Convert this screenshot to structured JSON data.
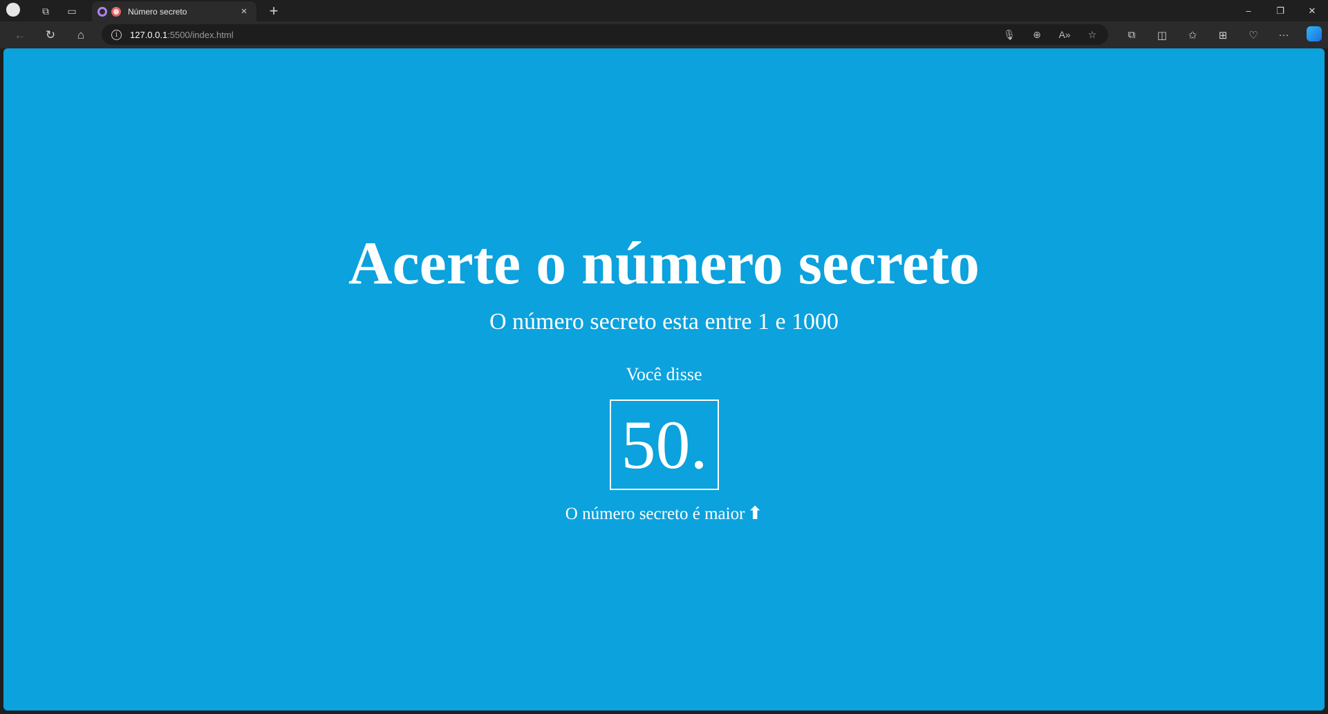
{
  "browser": {
    "tab": {
      "title": "Número secreto",
      "close": "×"
    },
    "new_tab": "+",
    "window_controls": {
      "minimize": "–",
      "restore": "❐",
      "close": "✕"
    },
    "nav": {
      "back": "←",
      "reload": "↻",
      "home": "⌂"
    },
    "address": {
      "host": "127.0.0.1",
      "path": ":5500/index.html",
      "info": "i"
    },
    "url_icons": {
      "mic": "🎙",
      "zoom": "⊕",
      "read_aloud": "A»",
      "favorite": "☆"
    },
    "toolbar_icons": {
      "extensions": "⧉",
      "split": "◫",
      "favorites": "✩",
      "collections": "⊞",
      "health": "♡",
      "more": "···"
    }
  },
  "page": {
    "heading": "Acerte o número secreto",
    "subheading": "O número secreto esta entre 1 e 1000",
    "said_label": "Você disse",
    "guess": "50.",
    "hint": "O número secreto é maior",
    "hint_arrow": "⬆"
  },
  "colors": {
    "background": "#0ba2dd",
    "text": "#ffffff"
  }
}
